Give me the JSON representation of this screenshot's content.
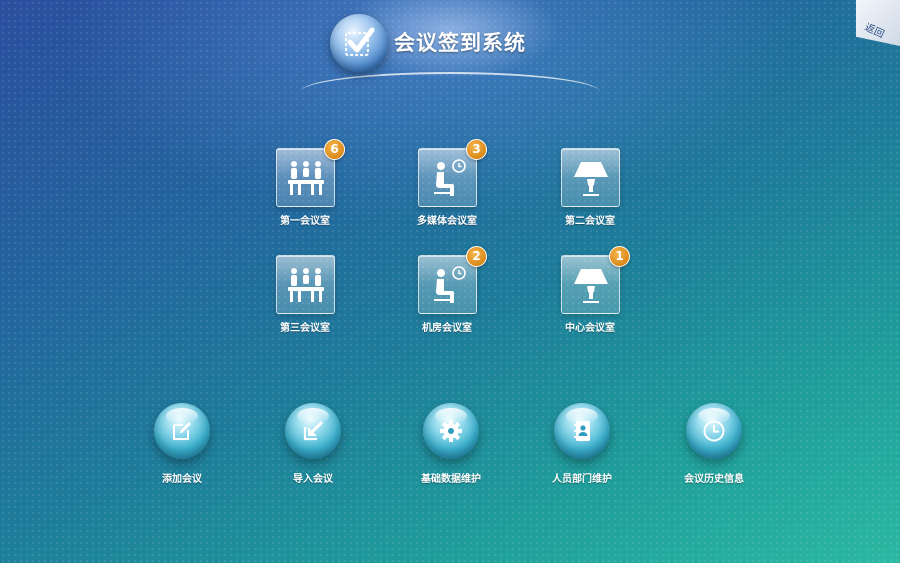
{
  "header": {
    "title": "会议签到系统",
    "logo_icon": "checkmark-icon"
  },
  "back": {
    "label": "返回"
  },
  "rooms": [
    {
      "label": "第一会议室",
      "icon": "meeting-table-icon",
      "badge": "6"
    },
    {
      "label": "多媒体会议室",
      "icon": "seated-person-clock-icon",
      "badge": "3"
    },
    {
      "label": "第二会议室",
      "icon": "lamp-icon",
      "badge": ""
    },
    {
      "label": "第三会议室",
      "icon": "meeting-table-icon",
      "badge": ""
    },
    {
      "label": "机房会议室",
      "icon": "seated-person-clock-icon",
      "badge": "2"
    },
    {
      "label": "中心会议室",
      "icon": "lamp-icon",
      "badge": "1"
    }
  ],
  "actions": [
    {
      "label": "添加会议",
      "icon": "edit-icon"
    },
    {
      "label": "导入会议",
      "icon": "import-icon"
    },
    {
      "label": "基础数据维护",
      "icon": "gear-icon"
    },
    {
      "label": "人员部门维护",
      "icon": "contacts-book-icon"
    },
    {
      "label": "会议历史信息",
      "icon": "clock-icon"
    }
  ],
  "colors": {
    "badge": "#e0901c",
    "background_top": "#2a4f9e",
    "background_bottom": "#2bb8a2"
  }
}
